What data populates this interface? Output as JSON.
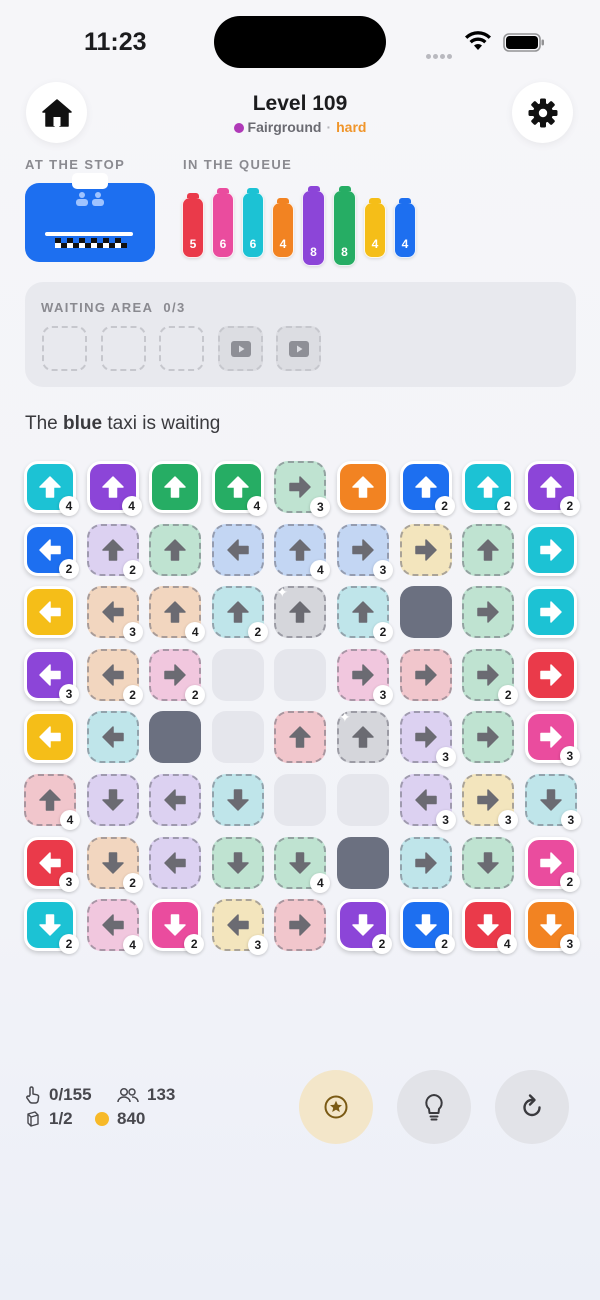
{
  "status_bar": {
    "time": "11:23"
  },
  "header": {
    "title": "Level 109",
    "location": "Fairground",
    "difficulty": "hard",
    "location_color": "#b03ab8",
    "difficulty_color": "#f0952a"
  },
  "stop": {
    "label": "AT THE STOP",
    "taxi_color": "blue"
  },
  "queue": {
    "label": "IN THE QUEUE",
    "items": [
      {
        "color": "red",
        "value": "5"
      },
      {
        "color": "pink",
        "value": "6"
      },
      {
        "color": "cyan",
        "value": "6"
      },
      {
        "color": "orange",
        "value": "4"
      },
      {
        "color": "purple",
        "value": "8"
      },
      {
        "color": "green",
        "value": "8"
      },
      {
        "color": "yellow",
        "value": "4"
      },
      {
        "color": "blue",
        "value": "4"
      }
    ]
  },
  "waiting_area": {
    "label": "WAITING AREA",
    "count": "0/3",
    "slots": 5,
    "ad_slots": 2
  },
  "message": {
    "prefix": "The ",
    "color_word": "blue",
    "suffix": " taxi is waiting"
  },
  "palette": {
    "cyan": "#1cc2d4",
    "purple": "#8c45d8",
    "green": "#26ad64",
    "orange": "#f28322",
    "blue": "#1d6ff0",
    "yellow": "#f5be18",
    "red": "#ea3a4a",
    "pink": "#ea4c9e",
    "gray": "#b5b6bc",
    "ghost_cyan": "#bfe5ea",
    "ghost_purple": "#dcd1f1",
    "ghost_green": "#bfe3d1",
    "ghost_blue": "#c3d6f3",
    "ghost_yellow": "#f3e5bd",
    "ghost_orange": "#f2d6bf",
    "ghost_pink": "#f1c7de",
    "ghost_red": "#f1c6cc",
    "ghost_gray": "#d5d6db"
  },
  "grid": {
    "columns": 9,
    "rows": [
      [
        {
          "c": "cyan",
          "d": "up",
          "s": 1,
          "n": "4"
        },
        {
          "c": "purple",
          "d": "up",
          "s": 1,
          "n": "4"
        },
        {
          "c": "green",
          "d": "up",
          "s": 1
        },
        {
          "c": "green",
          "d": "up",
          "s": 1,
          "n": "4"
        },
        {
          "c": "green",
          "d": "right",
          "s": 0,
          "n": "3"
        },
        {
          "c": "orange",
          "d": "up",
          "s": 1
        },
        {
          "c": "blue",
          "d": "up",
          "s": 1,
          "n": "2"
        },
        {
          "c": "cyan",
          "d": "up",
          "s": 1,
          "n": "2"
        },
        {
          "c": "purple",
          "d": "up",
          "s": 1,
          "n": "2"
        }
      ],
      [
        {
          "c": "blue",
          "d": "left",
          "s": 1,
          "n": "2"
        },
        {
          "c": "purple",
          "d": "up",
          "s": 0,
          "n": "2"
        },
        {
          "c": "green",
          "d": "up",
          "s": 0
        },
        {
          "c": "blue",
          "d": "left",
          "s": 0
        },
        {
          "c": "blue",
          "d": "up",
          "s": 0,
          "n": "4"
        },
        {
          "c": "blue",
          "d": "right",
          "s": 0,
          "n": "3"
        },
        {
          "c": "yellow",
          "d": "right",
          "s": 0
        },
        {
          "c": "green",
          "d": "up",
          "s": 0
        },
        {
          "c": "cyan",
          "d": "right",
          "s": 1
        }
      ],
      [
        {
          "c": "yellow",
          "d": "left",
          "s": 1
        },
        {
          "c": "orange",
          "d": "left",
          "s": 0,
          "n": "3"
        },
        {
          "c": "orange",
          "d": "up",
          "s": 0,
          "n": "4"
        },
        {
          "c": "cyan",
          "d": "up",
          "s": 0,
          "n": "2"
        },
        {
          "c": "gray",
          "d": "up",
          "s": 0,
          "sp": 1
        },
        {
          "c": "cyan",
          "d": "up",
          "s": 0,
          "n": "2"
        },
        {
          "t": "block"
        },
        {
          "c": "green",
          "d": "right",
          "s": 0
        },
        {
          "c": "cyan",
          "d": "right",
          "s": 1
        }
      ],
      [
        {
          "c": "purple",
          "d": "left",
          "s": 1,
          "n": "3"
        },
        {
          "c": "orange",
          "d": "left",
          "s": 0,
          "n": "2"
        },
        {
          "c": "pink",
          "d": "right",
          "s": 0,
          "n": "2"
        },
        {
          "t": "empty"
        },
        {
          "t": "empty"
        },
        {
          "c": "pink",
          "d": "right",
          "s": 0,
          "n": "3"
        },
        {
          "c": "red",
          "d": "right",
          "s": 0
        },
        {
          "c": "green",
          "d": "right",
          "s": 0,
          "n": "2"
        },
        {
          "c": "red",
          "d": "right",
          "s": 1
        }
      ],
      [
        {
          "c": "yellow",
          "d": "left",
          "s": 1
        },
        {
          "c": "cyan",
          "d": "left",
          "s": 0
        },
        {
          "t": "block"
        },
        {
          "t": "empty"
        },
        {
          "c": "red",
          "d": "up",
          "s": 0
        },
        {
          "c": "gray",
          "d": "up",
          "s": 0,
          "sp": 1
        },
        {
          "c": "purple",
          "d": "right",
          "s": 0,
          "n": "3"
        },
        {
          "c": "green",
          "d": "right",
          "s": 0
        },
        {
          "c": "pink",
          "d": "right",
          "s": 1,
          "n": "3"
        }
      ],
      [
        {
          "c": "red",
          "d": "up",
          "s": 0,
          "n": "4"
        },
        {
          "c": "purple",
          "d": "down",
          "s": 0
        },
        {
          "c": "purple",
          "d": "left",
          "s": 0
        },
        {
          "c": "cyan",
          "d": "down",
          "s": 0
        },
        {
          "t": "empty"
        },
        {
          "t": "empty"
        },
        {
          "c": "purple",
          "d": "left",
          "s": 0,
          "n": "3"
        },
        {
          "c": "yellow",
          "d": "right",
          "s": 0,
          "n": "3"
        },
        {
          "c": "cyan",
          "d": "down",
          "s": 0,
          "n": "3"
        }
      ],
      [
        {
          "c": "red",
          "d": "left",
          "s": 1,
          "n": "3"
        },
        {
          "c": "orange",
          "d": "down",
          "s": 0,
          "n": "2"
        },
        {
          "c": "purple",
          "d": "left",
          "s": 0
        },
        {
          "c": "green",
          "d": "down",
          "s": 0
        },
        {
          "c": "green",
          "d": "down",
          "s": 0,
          "n": "4"
        },
        {
          "t": "block"
        },
        {
          "c": "cyan",
          "d": "right",
          "s": 0
        },
        {
          "c": "green",
          "d": "down",
          "s": 0
        },
        {
          "c": "pink",
          "d": "right",
          "s": 1,
          "n": "2"
        }
      ],
      [
        {
          "c": "cyan",
          "d": "down",
          "s": 1,
          "n": "2"
        },
        {
          "c": "pink",
          "d": "left",
          "s": 0,
          "n": "4"
        },
        {
          "c": "pink",
          "d": "down",
          "s": 1,
          "n": "2"
        },
        {
          "c": "yellow",
          "d": "left",
          "s": 0,
          "n": "3"
        },
        {
          "c": "red",
          "d": "right",
          "s": 0
        },
        {
          "c": "purple",
          "d": "down",
          "s": 1,
          "n": "2"
        },
        {
          "c": "blue",
          "d": "down",
          "s": 1,
          "n": "2"
        },
        {
          "c": "red",
          "d": "down",
          "s": 1,
          "n": "4"
        },
        {
          "c": "orange",
          "d": "down",
          "s": 1,
          "n": "3"
        }
      ]
    ]
  },
  "stats": {
    "taps": "0/155",
    "passengers": "133",
    "packs": "1/2",
    "coins": "840"
  },
  "actions": {
    "star": "star-button",
    "hint": "hint-button",
    "restart": "restart-button"
  }
}
